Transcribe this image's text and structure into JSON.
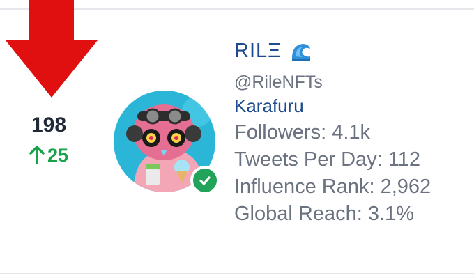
{
  "ranking": {
    "rank": "198",
    "change": "25",
    "change_direction": "up",
    "colors": {
      "down_arrow": "#e01010",
      "change": "#16a34a",
      "rank": "#1f2937"
    }
  },
  "profile": {
    "name": "RILΞ",
    "name_icon": "wave-icon",
    "handle": "@RileNFTs",
    "project": "Karafuru",
    "verified": true,
    "colors": {
      "link": "#1e4b8f",
      "muted": "#6b7280",
      "verified": "#22a35a"
    }
  },
  "stats": {
    "followers": "Followers: 4.1k",
    "tweets_per_day": "Tweets Per Day: 112",
    "influence_rank": "Influence Rank: 2,962",
    "global_reach": "Global Reach: 3.1%"
  }
}
